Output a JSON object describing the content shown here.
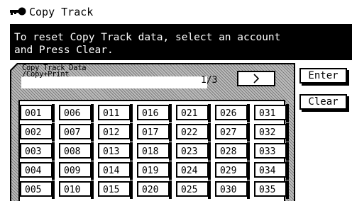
{
  "title_bar": {
    "icon": "key-icon",
    "title": "Copy Track"
  },
  "message": {
    "line1": "To reset Copy Track data, select an account",
    "line2": "and Press Clear."
  },
  "panel": {
    "title_line1": "Copy Track Data",
    "title_line2": "/Copy+Print",
    "page_indicator": "1/3",
    "next_icon": "chevron-right-icon"
  },
  "buttons": {
    "enter": "Enter",
    "clear": "Clear"
  },
  "accounts": [
    [
      "001",
      "006",
      "011",
      "016",
      "021",
      "026",
      "031"
    ],
    [
      "002",
      "007",
      "012",
      "017",
      "022",
      "027",
      "032"
    ],
    [
      "003",
      "008",
      "013",
      "018",
      "023",
      "028",
      "033"
    ],
    [
      "004",
      "009",
      "014",
      "019",
      "024",
      "029",
      "034"
    ],
    [
      "005",
      "010",
      "015",
      "020",
      "025",
      "030",
      "035"
    ]
  ]
}
